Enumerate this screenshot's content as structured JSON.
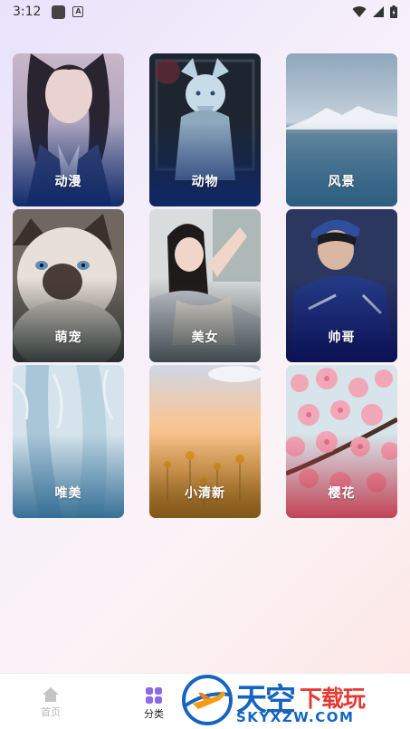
{
  "status_bar": {
    "time": "3:12"
  },
  "categories": [
    {
      "label": "动漫"
    },
    {
      "label": "动物"
    },
    {
      "label": "风景"
    },
    {
      "label": "萌宠"
    },
    {
      "label": "美女"
    },
    {
      "label": "帅哥"
    },
    {
      "label": "唯美"
    },
    {
      "label": "小清新"
    },
    {
      "label": "樱花"
    }
  ],
  "tabbar": {
    "home_label": "首页",
    "category_label": "分类"
  },
  "watermark": {
    "title_blue": "天空",
    "title_red": "下载玩",
    "url": "SKYXZW.COM"
  },
  "colors": {
    "accent": "#8a6be6",
    "inactive": "#b9b9b9"
  }
}
